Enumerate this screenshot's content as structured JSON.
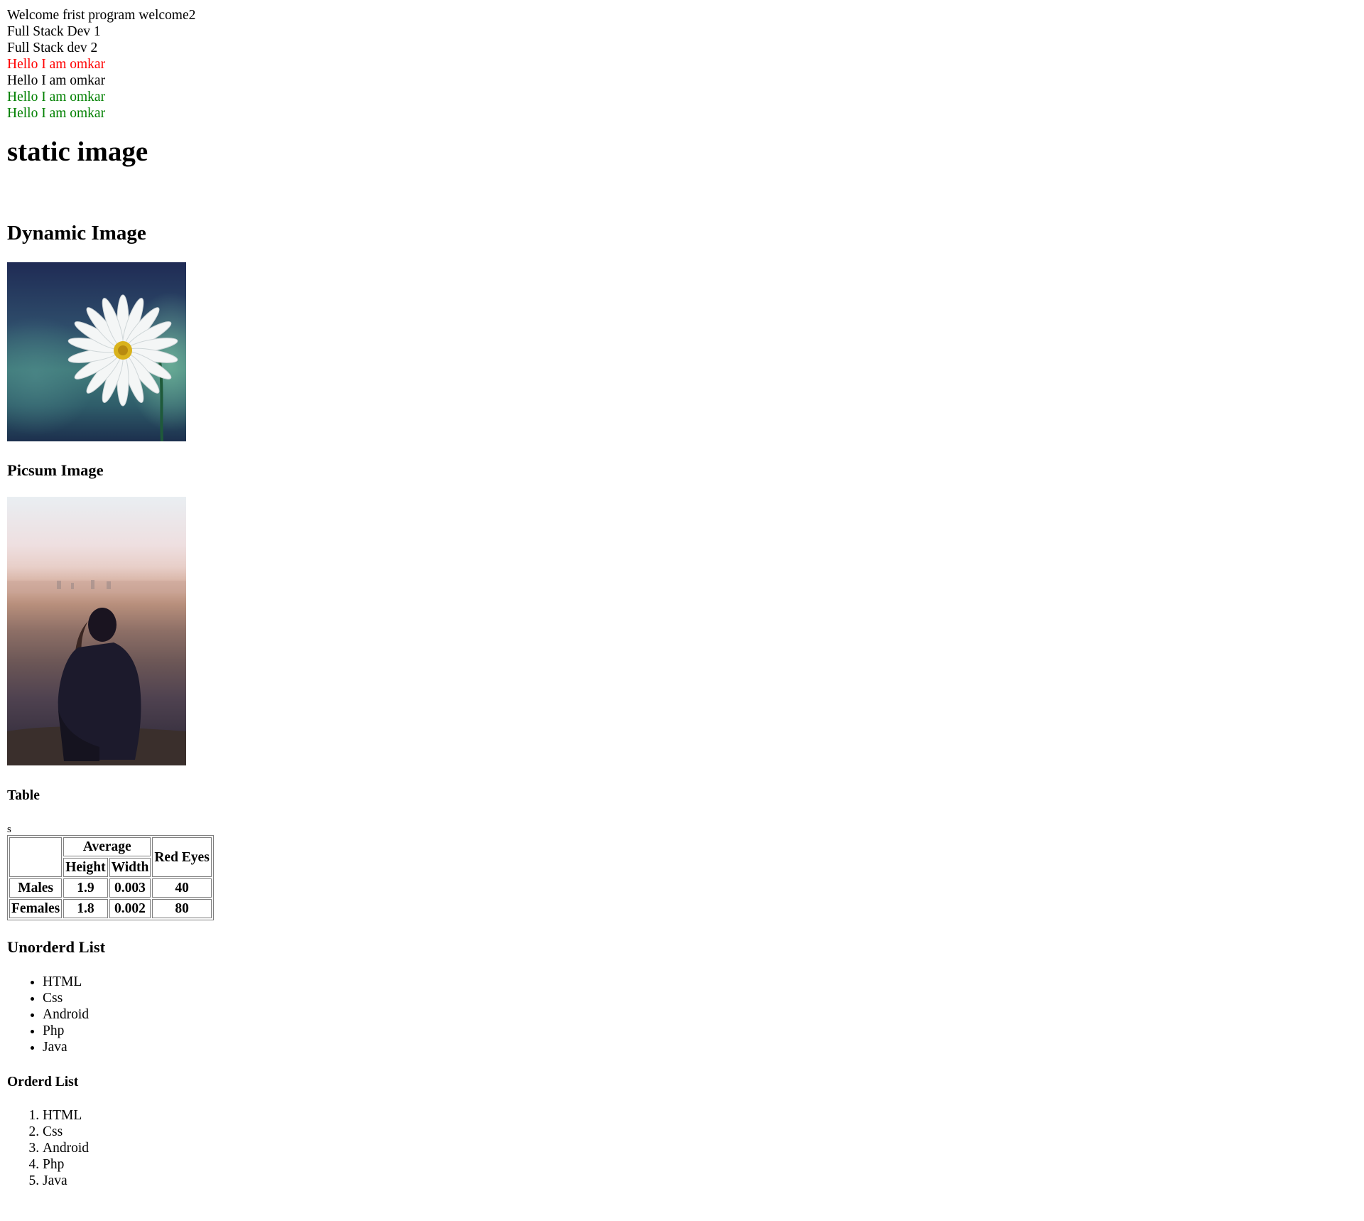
{
  "intro_lines": [
    {
      "text": "Welcome frist program welcome2",
      "color": "#000000"
    },
    {
      "text": "Full Stack Dev 1",
      "color": "#000000"
    },
    {
      "text": "Full Stack dev 2",
      "color": "#000000"
    },
    {
      "text": "Hello I am omkar",
      "color": "#ff0000"
    },
    {
      "text": "Hello I am omkar",
      "color": "#000000"
    },
    {
      "text": "Hello I am omkar",
      "color": "#008000"
    },
    {
      "text": "Hello I am omkar",
      "color": "#008000"
    }
  ],
  "headings": {
    "static_image": "static image",
    "dynamic_image": "Dynamic Image",
    "picsum_image": "Picsum Image",
    "table": "Table",
    "unordered_list": "Unorderd List",
    "ordered_list": "Orderd List"
  },
  "stray_text": "s",
  "table": {
    "group_header": "Average",
    "col_height": "Height",
    "col_width": "Width",
    "col_red_eyes": "Red Eyes",
    "rows": [
      {
        "label": "Males",
        "height": "1.9",
        "width": "0.003",
        "red_eyes": "40"
      },
      {
        "label": "Females",
        "height": "1.8",
        "width": "0.002",
        "red_eyes": "80"
      }
    ]
  },
  "unordered_list": [
    "HTML",
    "Css",
    "Android",
    "Php",
    "Java"
  ],
  "ordered_list": [
    "HTML",
    "Css",
    "Android",
    "Php",
    "Java"
  ]
}
